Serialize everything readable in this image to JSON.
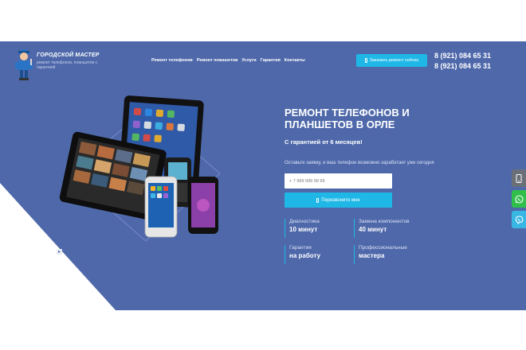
{
  "colors": {
    "hero_bg": "#4e68aa",
    "accent": "#1fb8e6",
    "text": "#ffffff"
  },
  "logo": {
    "title": "ГОРОДСКОЙ МАСТЕР",
    "subtitle": "ремонт телефонов, планшетов с гарантией"
  },
  "nav": {
    "items": [
      "Ремонт телефонов",
      "Ремонт планшетов",
      "Услуги",
      "Гарантия",
      "Контакты"
    ]
  },
  "header": {
    "order_button": "Заказать ремонт сейчас",
    "phones": [
      "8 (921) 084 65 31",
      "8 (921) 084 65 31"
    ]
  },
  "hero": {
    "headline": "РЕМОНТ ТЕЛЕФОНОВ И ПЛАНШЕТОВ В ОРЛЕ",
    "guarantee": "С гарантией от 6 месяцев!",
    "prompt": "Оставьте заявку, и ваш телефон возможно заработает уже сегодня",
    "phone_placeholder": "+ 7 999 999 99 99",
    "call_button": "Перезвоните мне"
  },
  "features": [
    {
      "label": "Диагностика",
      "value": "10 минут"
    },
    {
      "label": "Замена компонентов",
      "value": "40 минут"
    },
    {
      "label": "Гарантия",
      "value": "на работу"
    },
    {
      "label": "Профессиональные",
      "value": "мастера"
    }
  ],
  "side_icons": [
    "phone-icon",
    "whatsapp-icon",
    "viber-icon"
  ]
}
